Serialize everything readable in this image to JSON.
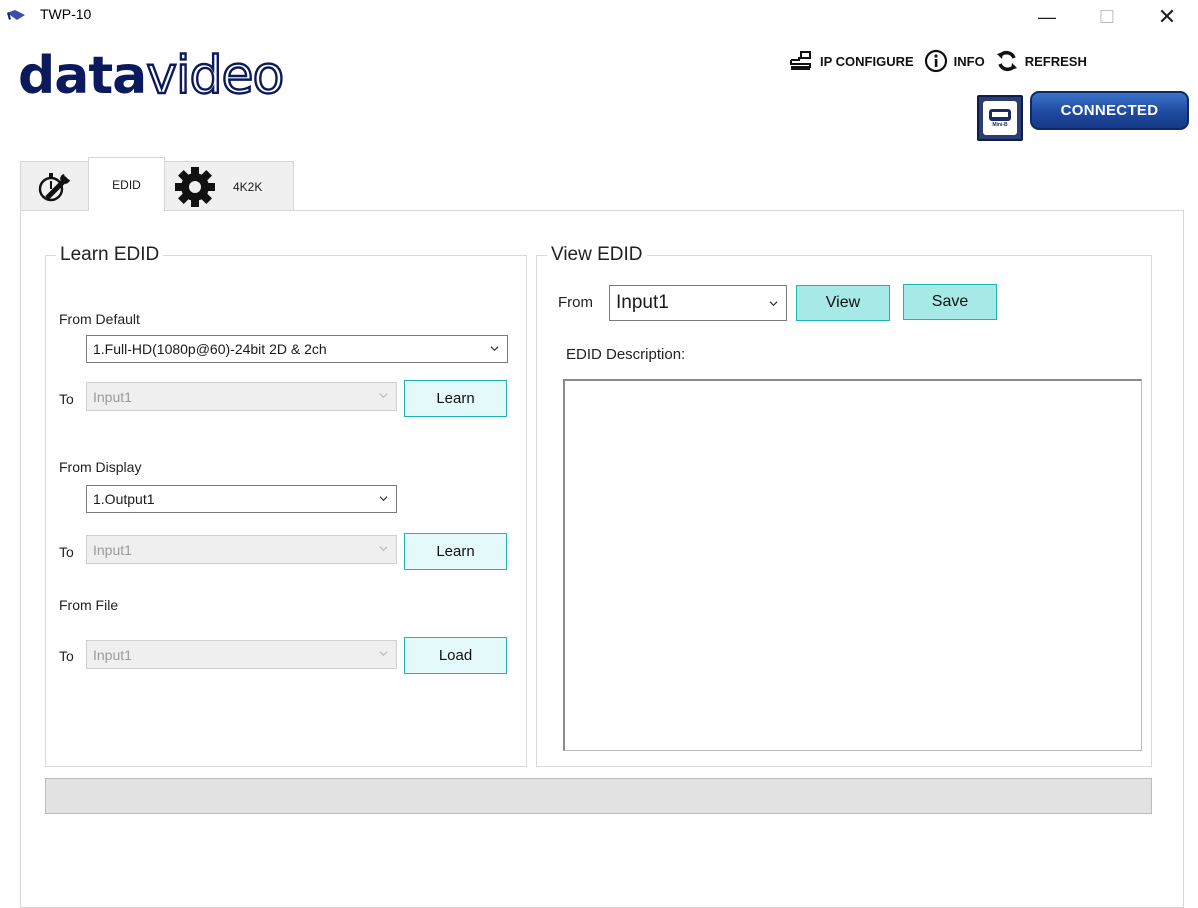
{
  "window": {
    "title": "TWP-10",
    "minimize": "—",
    "maximize": "☐",
    "close": "✕"
  },
  "logo": {
    "part1": "data",
    "part2": "video"
  },
  "toolbar": {
    "ip_configure": "IP CONFIGURE",
    "info": "INFO",
    "refresh": "REFRESH"
  },
  "usb": {
    "label": "Mini-B"
  },
  "status": {
    "connected": "CONNECTED"
  },
  "tabs": {
    "edid": "EDID",
    "k4k2k": "4K2K"
  },
  "learn": {
    "title": "Learn EDID",
    "from_default": "From Default",
    "default_value": "1.Full-HD(1080p@60)-24bit 2D & 2ch",
    "to1": "To",
    "to1_value": "Input1",
    "learn1": "Learn",
    "from_display": "From Display",
    "display_value": "1.Output1",
    "to2": "To",
    "to2_value": "Input1",
    "learn2": "Learn",
    "from_file": "From File",
    "to3": "To",
    "to3_value": "Input1",
    "load": "Load"
  },
  "view": {
    "title": "View EDID",
    "from_label": "From",
    "from_value": "Input1",
    "view_btn": "View",
    "save_btn": "Save",
    "desc_label": "EDID Description:"
  },
  "colors": {
    "brand_navy": "#0b1a5c",
    "connected_blue": "#1f4aa0",
    "button_teal": "#a7e9e7"
  }
}
